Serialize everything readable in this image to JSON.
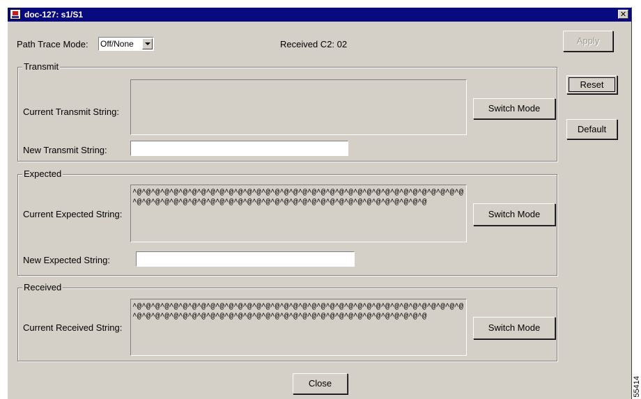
{
  "window": {
    "title": "doc-127: s1/S1",
    "close_glyph": "✕"
  },
  "path_trace": {
    "label": "Path Trace Mode:",
    "selected": "Off/None"
  },
  "received_c2": "Received C2: 02",
  "side_buttons": {
    "apply": "Apply",
    "reset": "Reset",
    "default": "Default"
  },
  "transmit": {
    "legend": "Transmit",
    "current_label": "Current Transmit String:",
    "current_value": "",
    "switch_label": "Switch Mode",
    "new_label": "New Transmit String:",
    "new_value": ""
  },
  "expected": {
    "legend": "Expected",
    "current_label": "Current Expected String:",
    "current_value": "^@^@^@^@^@^@^@^@^@^@^@^@^@^@^@^@^@^@^@^@^@^@^@^@^@^@^@^@^@^@^@^@^@^@^@^@^@^@^@^@^@^@^@^@^@^@^@^@^@^@^@^@^@^@^@^@^@^@^@^@^@^@^@^@^@^@^@^@",
    "switch_label": "Switch Mode",
    "new_label": "New Expected String:",
    "new_value": ""
  },
  "received": {
    "legend": "Received",
    "current_label": "Current Received String:",
    "current_value": "^@^@^@^@^@^@^@^@^@^@^@^@^@^@^@^@^@^@^@^@^@^@^@^@^@^@^@^@^@^@^@^@^@^@^@^@^@^@^@^@^@^@^@^@^@^@^@^@^@^@^@^@^@^@^@^@^@^@^@^@^@^@^@^@^@^@^@^@",
    "switch_label": "Switch Mode"
  },
  "close_button": "Close",
  "figure_number": "55414",
  "colors": {
    "titlebar": "#0a0a80",
    "face": "#d4d0c8"
  },
  "icons": {
    "app": "app-window-icon",
    "close": "close-icon",
    "dropdown": "chevron-down-icon"
  }
}
